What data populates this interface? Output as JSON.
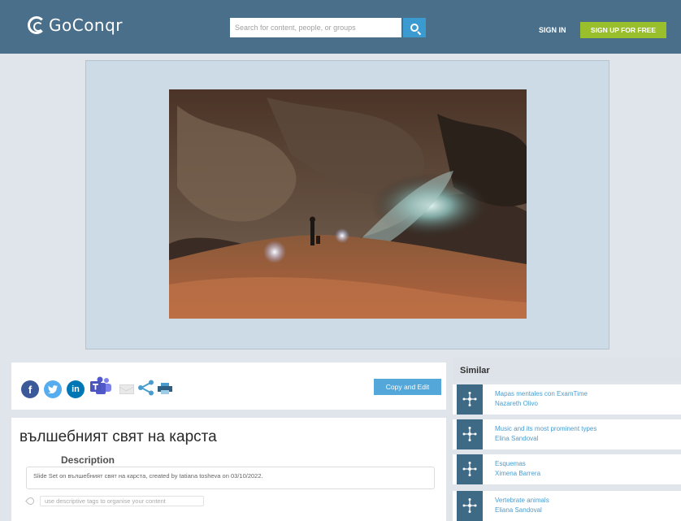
{
  "header": {
    "logo": "GoConqr",
    "search_placeholder": "Search for content, people, or groups",
    "sign_in": "SIGN IN",
    "sign_up": "SIGN UP FOR FREE"
  },
  "colors": {
    "header_bg": "#4a6f8a",
    "accent_blue": "#3b9bd1",
    "signup_green": "#9abf2d",
    "page_bg": "#dfe5ea"
  },
  "share": {
    "icons": [
      "facebook-icon",
      "twitter-icon",
      "linkedin-icon",
      "teams-icon",
      "email-icon",
      "share-icon",
      "print-icon"
    ],
    "copy_and_edit": "Copy and Edit"
  },
  "resource": {
    "title": "вълшебният свят на карста",
    "description_label": "Description",
    "description": "Slide Set on вълшебният свят на карста, created by tatiana tosheva on 03/10/2022.",
    "tags_placeholder": "use descriptive tags to organise your content"
  },
  "similar": {
    "heading": "Similar",
    "items": [
      {
        "title": "Mapas mentales con ExamTime",
        "author": "Nazareth Olivo"
      },
      {
        "title": "Music and its most prominent types",
        "author": "Elina Sandoval"
      },
      {
        "title": "Esquemas",
        "author": "Ximena Barrera"
      },
      {
        "title": "Vertebrate animals",
        "author": "Eliana Sandoval"
      }
    ]
  }
}
